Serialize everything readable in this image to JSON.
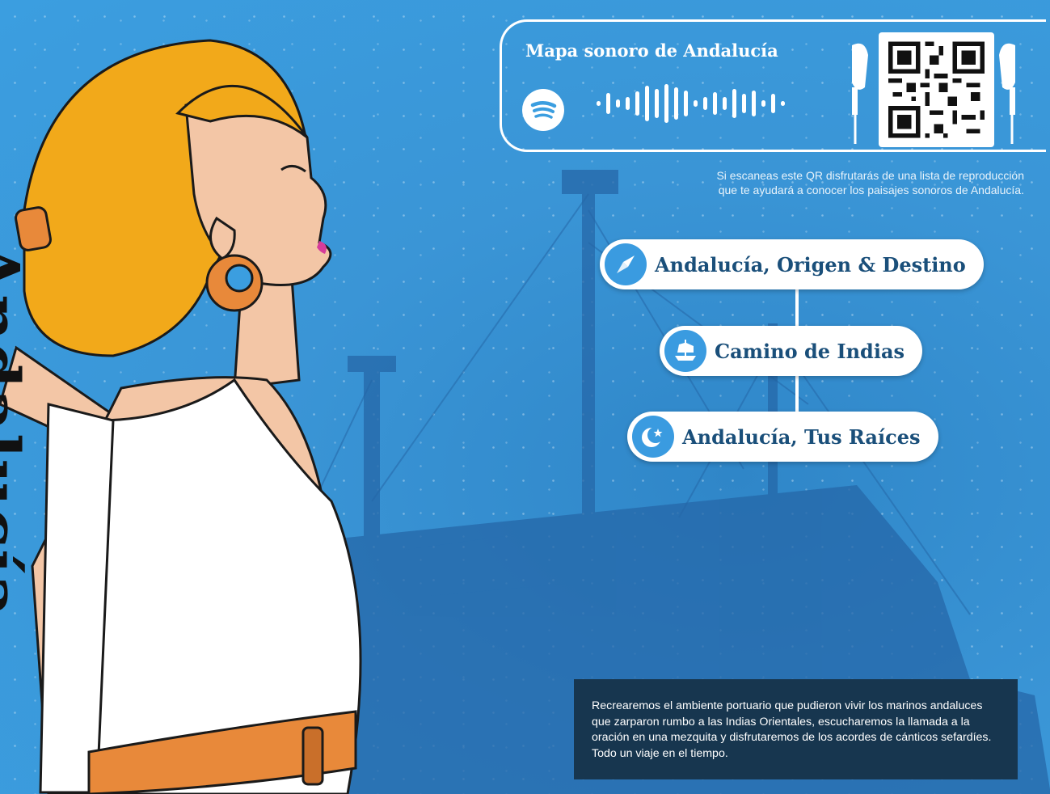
{
  "brand_word": "Andalucía",
  "spotify": {
    "title": "Mapa sonoro de Andalucía",
    "logo_icon": "spotify-logo-icon",
    "qr_icon": "qr-code-icon"
  },
  "qr_note": {
    "line1": "Si escaneas este QR disfrutarás de una lista de reproducción",
    "line2": "que te ayudará a conocer los paisajes sonoros de Andalucía."
  },
  "routes": [
    {
      "label": "Andalucía, Origen & Destino",
      "icon": "compass-icon"
    },
    {
      "label": "Camino de Indias",
      "icon": "ship-icon"
    },
    {
      "label": "Andalucía, Tus Raíces",
      "icon": "crescent-star-icon"
    }
  ],
  "description": "Recrearemos el ambiente portuario que pudieron vivir los marinos andaluces que zarparon rumbo a las Indias Orientales, escucharemos la llamada a la oración en una mezquita y disfrutaremos de los acordes de cánticos sefardíes. Todo un viaje en el tiempo.",
  "colors": {
    "background": "#3b9ee0",
    "pill_text": "#1a4f7a",
    "description_bg": "#17364f",
    "hair": "#f2a91a",
    "earring": "#e8893a"
  }
}
